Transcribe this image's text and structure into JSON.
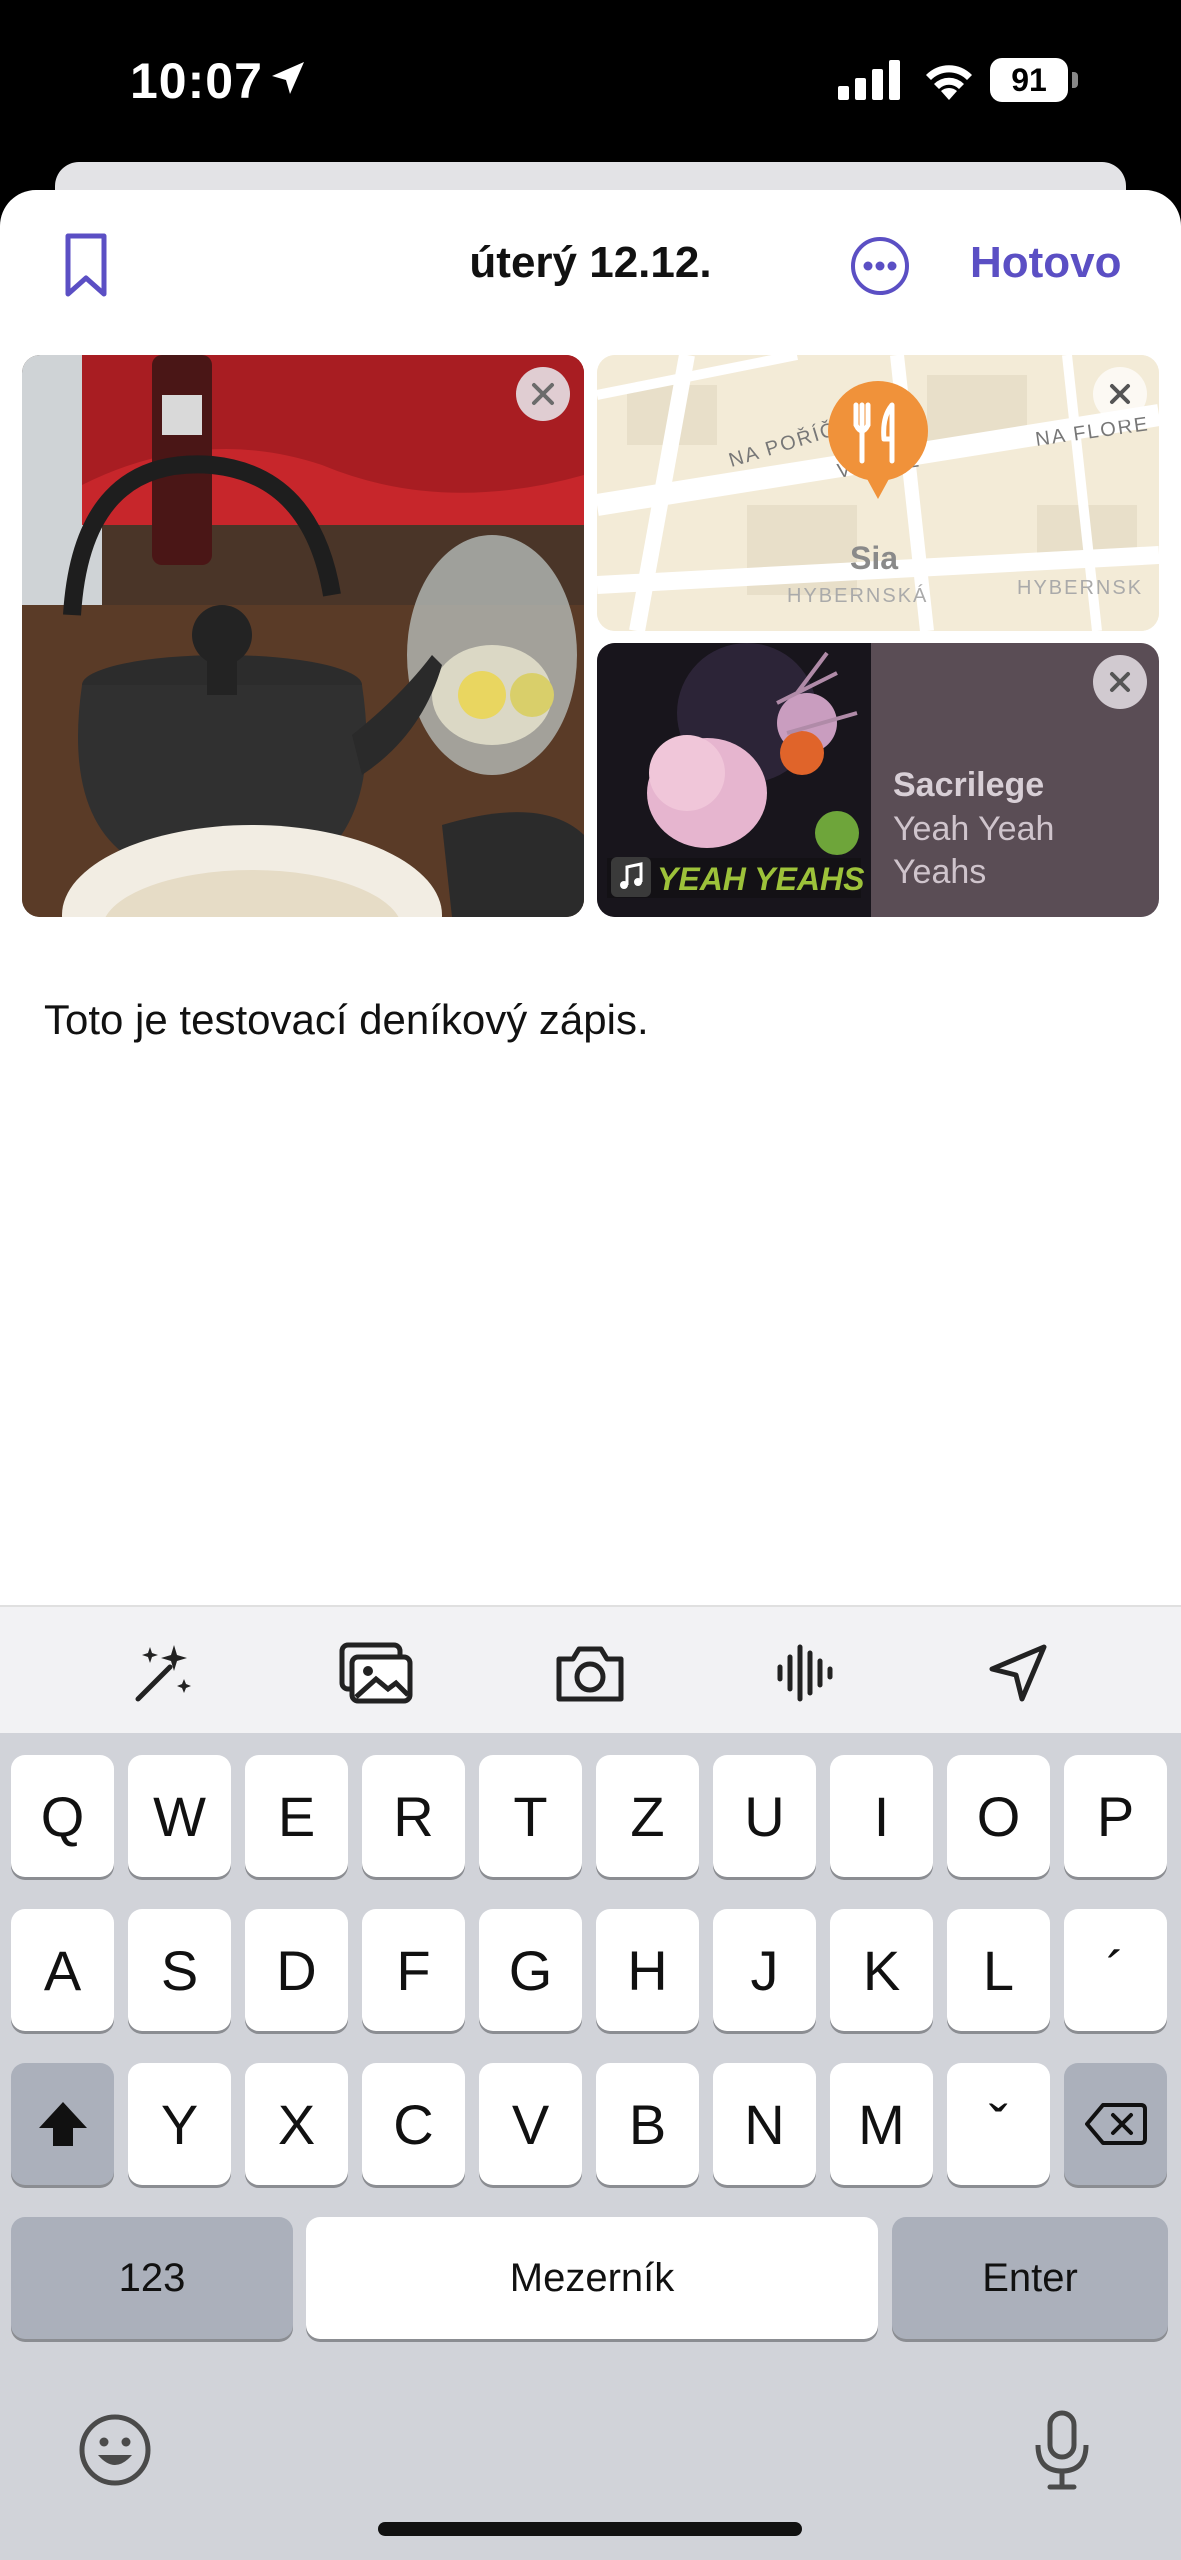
{
  "status_bar": {
    "time": "10:07",
    "battery": "91"
  },
  "header": {
    "date": "úterý 12.12.",
    "done_label": "Hotovo",
    "accent": "#5b4fc4"
  },
  "attachments": {
    "map": {
      "place": "Sia",
      "street_labels": [
        "NA POŘÍČÍ",
        "NA FLORE",
        "V JÁMĚ",
        "HYBERNSKÁ",
        "HYBERNSK"
      ]
    },
    "music": {
      "song": "Sacrilege",
      "artist": "Yeah Yeah Yeahs",
      "album_text": "YEAH YEAHS"
    }
  },
  "entry": {
    "text": "Toto je testovací deníkový zápis."
  },
  "toolbar": {
    "icons": [
      "magic-wand-icon",
      "photo-library-icon",
      "camera-icon",
      "audio-waveform-icon",
      "location-arrow-icon"
    ]
  },
  "keyboard": {
    "row1": [
      "Q",
      "W",
      "E",
      "R",
      "T",
      "Z",
      "U",
      "I",
      "O",
      "P"
    ],
    "row2": [
      "A",
      "S",
      "D",
      "F",
      "G",
      "H",
      "J",
      "K",
      "L",
      "´"
    ],
    "row3": [
      "Y",
      "X",
      "C",
      "V",
      "B",
      "N",
      "M",
      "ˇ"
    ],
    "numbers_label": "123",
    "space_label": "Mezerník",
    "enter_label": "Enter"
  }
}
